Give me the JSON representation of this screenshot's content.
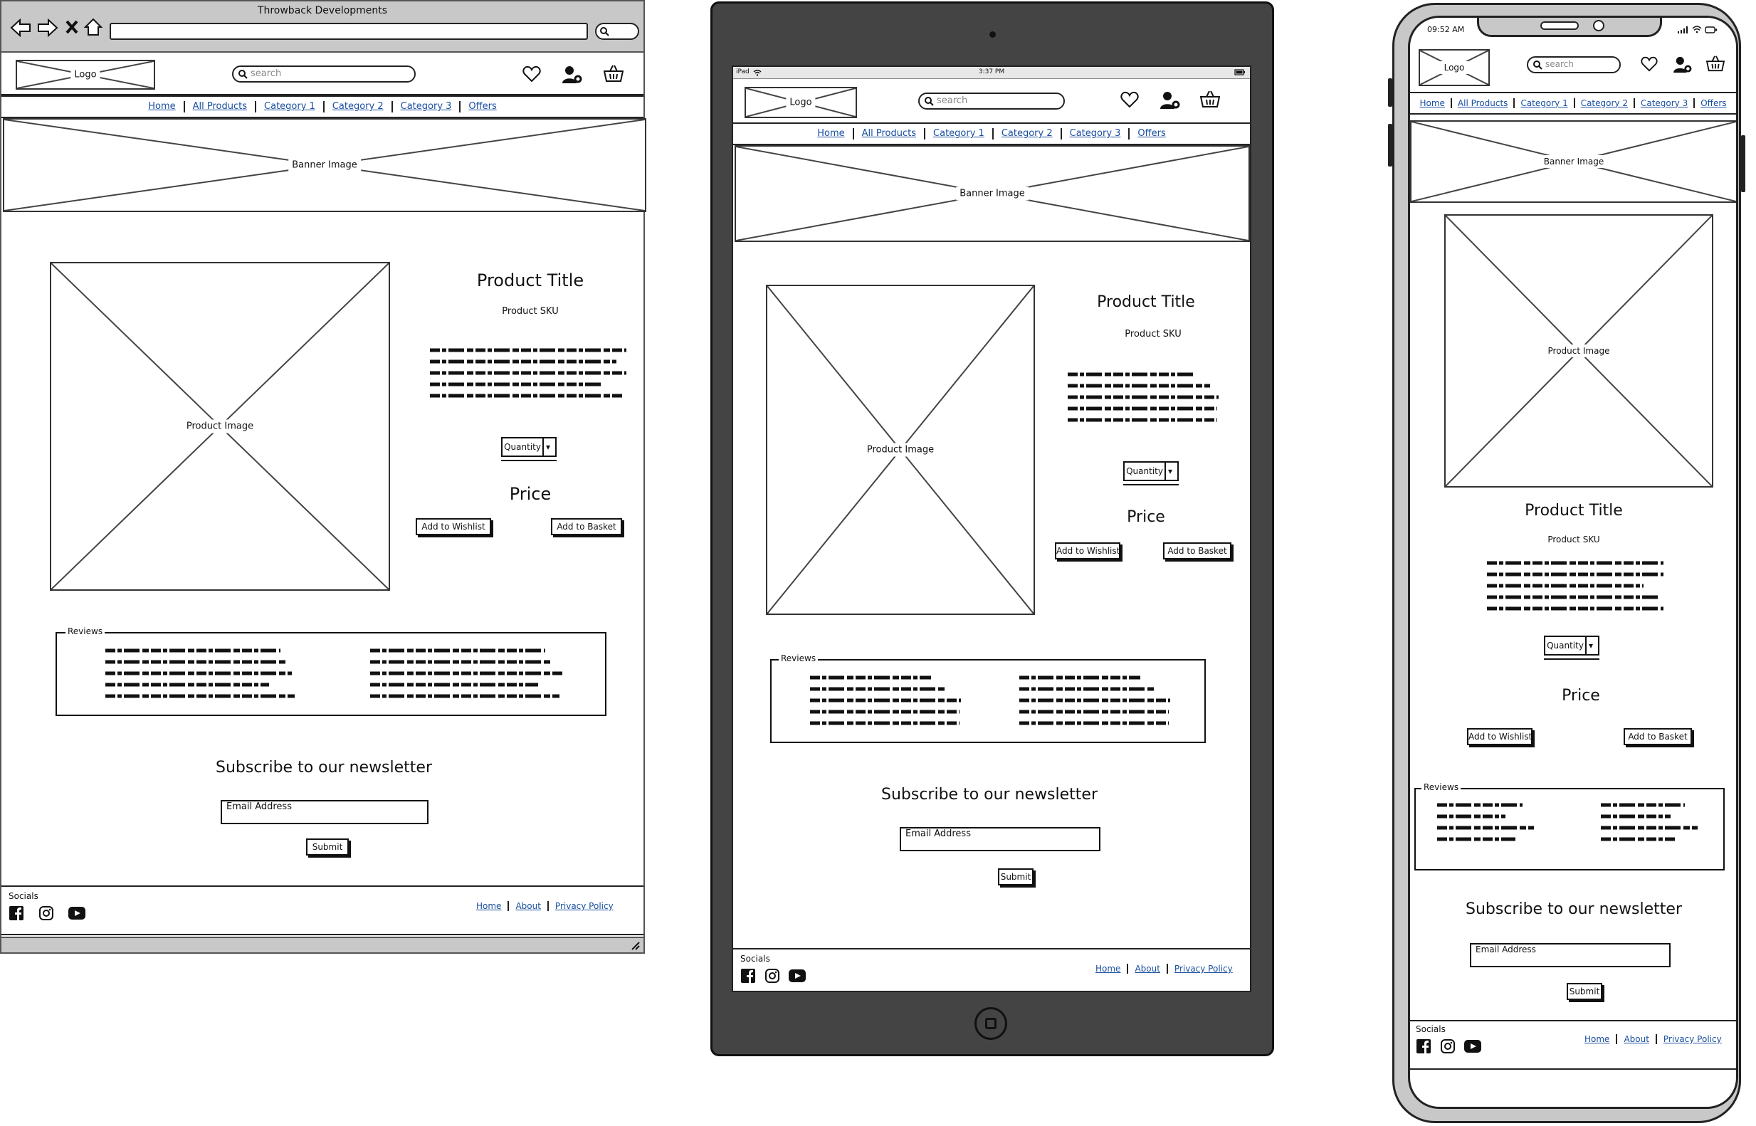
{
  "browser": {
    "title": "Throwback Developments"
  },
  "ipad": {
    "carrier": "iPad",
    "time": "3:37 PM"
  },
  "phone": {
    "time": "09:52 AM"
  },
  "header": {
    "logo": "Logo",
    "search_placeholder": "search"
  },
  "nav": {
    "items": [
      "Home",
      "All Products",
      "Category 1",
      "Category 2",
      "Category 3",
      "Offers"
    ]
  },
  "banner": {
    "label": "Banner Image"
  },
  "product": {
    "image_label": "Product Image",
    "title": "Product Title",
    "sku": "Product SKU",
    "quantity_label": "Quantity",
    "price": "Price",
    "wishlist_button": "Add to Wishlist",
    "basket_button": "Add to Basket"
  },
  "reviews": {
    "legend": "Reviews"
  },
  "newsletter": {
    "title": "Subscribe to our newsletter",
    "email_placeholder": "Email Address",
    "submit": "Submit"
  },
  "footer": {
    "socials_label": "Socials",
    "links": [
      "Home",
      "About",
      "Privacy Policy"
    ]
  },
  "icons": [
    "back-arrow-icon",
    "forward-arrow-icon",
    "close-icon",
    "home-icon",
    "search-icon",
    "heart-icon",
    "user-settings-icon",
    "basket-icon",
    "facebook-icon",
    "instagram-icon",
    "youtube-icon",
    "wifi-icon",
    "battery-icon",
    "signal-icon",
    "camera-icon",
    "home-button-icon",
    "resize-grip-icon"
  ]
}
